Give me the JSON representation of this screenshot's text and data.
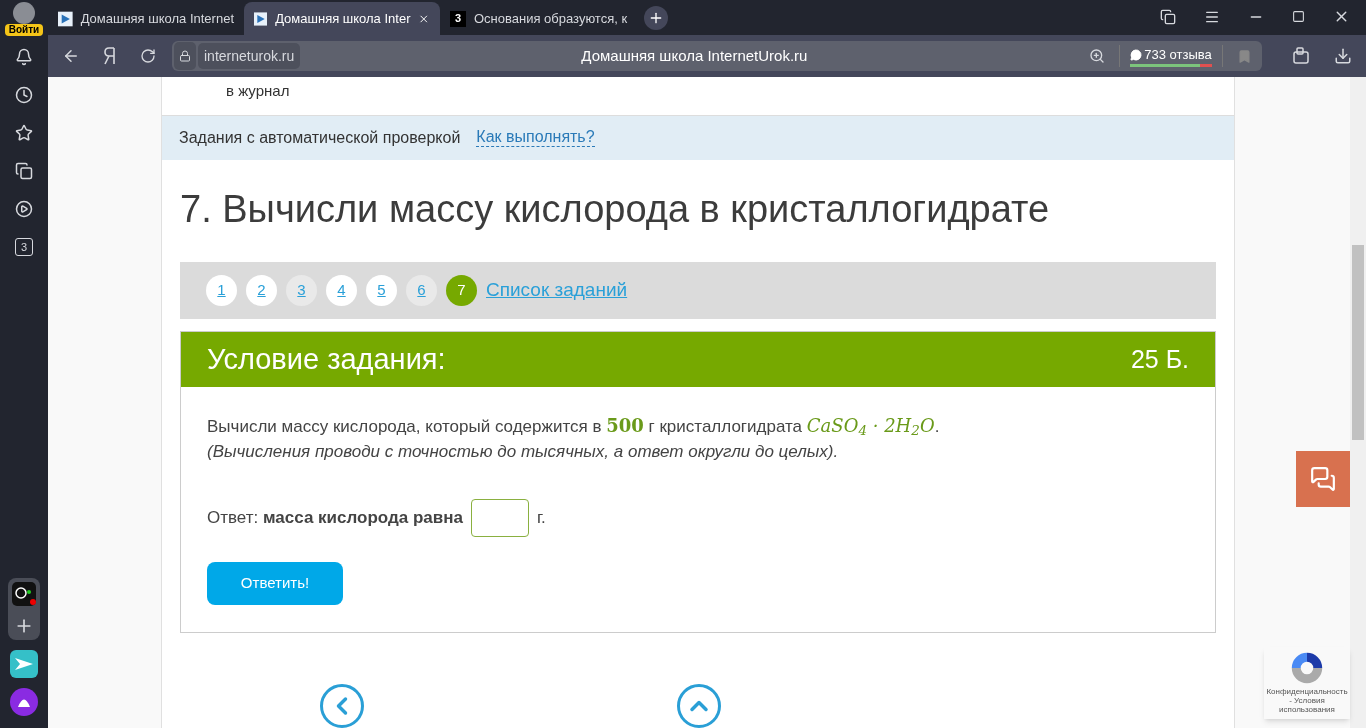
{
  "browser": {
    "profile": {
      "label": "Войти"
    },
    "tabs": [
      {
        "title": "Домашняя школа Internet",
        "selected": false,
        "kind": "play"
      },
      {
        "title": "Домашняя школа Inter",
        "selected": true,
        "kind": "play"
      },
      {
        "title": "Основания образуются, к",
        "selected": false,
        "kind": "letter",
        "favicon_text": "3"
      }
    ],
    "address": {
      "domain": "interneturok.ru",
      "page_title": "Домашняя школа InternetUrok.ru",
      "reviews": "733 отзыва"
    },
    "sidebar_badge": "3"
  },
  "page": {
    "journal_text": "в журнал",
    "info_band": {
      "text": "Задания с автоматической проверкой",
      "link": "Как выполнять?"
    },
    "title": "7. Вычисли массу кислорода в кристаллогидрате",
    "pager": {
      "items": [
        {
          "label": "1",
          "selected": false,
          "answered": false
        },
        {
          "label": "2",
          "selected": false,
          "answered": false
        },
        {
          "label": "3",
          "selected": false,
          "answered": true
        },
        {
          "label": "4",
          "selected": false,
          "answered": false
        },
        {
          "label": "5",
          "selected": false,
          "answered": false
        },
        {
          "label": "6",
          "selected": false,
          "answered": true
        },
        {
          "label": "7",
          "selected": true,
          "answered": false
        }
      ],
      "list_link": "Список заданий"
    },
    "task": {
      "heading": "Условие задания:",
      "points": "25 Б.",
      "question": {
        "before": "Вычисли массу кислорода, который содержится в",
        "number": "500",
        "middle": "г кристаллогидрата",
        "formula": "CaSO$_{4}$ · 2H$_{2}$O",
        "end": "."
      },
      "note": "(Вычисления проводи с точностью до тысячных, а ответ округли до целых).",
      "answer": {
        "label": "Ответ:",
        "bold": "масса кислорода равна",
        "unit": "г."
      },
      "submit": "Ответить!"
    },
    "recaptcha": "Конфиденциальность - Условия использования"
  }
}
